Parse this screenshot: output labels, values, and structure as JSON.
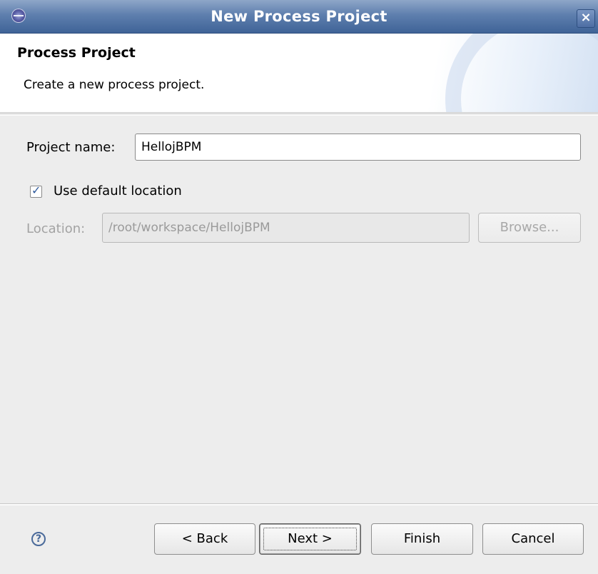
{
  "window": {
    "title": "New Process Project",
    "close_icon": "close-icon",
    "app_icon": "eclipse-app-icon"
  },
  "banner": {
    "title": "Process Project",
    "description": "Create a new process project."
  },
  "form": {
    "project_name_label": "Project name:",
    "project_name_value": "HellojBPM",
    "use_default_location_label": "Use default location",
    "use_default_location_checked": true,
    "location_label": "Location:",
    "location_value": "/root/workspace/HellojBPM",
    "browse_label": "Browse..."
  },
  "footer": {
    "help_icon": "help-icon",
    "back_label": "< Back",
    "next_label": "Next >",
    "finish_label": "Finish",
    "cancel_label": "Cancel"
  },
  "colors": {
    "titlebar": "#4f72a4",
    "window_bg": "#ededed",
    "banner_bg": "#ffffff",
    "checkbox_mark": "#2f5a9c"
  }
}
